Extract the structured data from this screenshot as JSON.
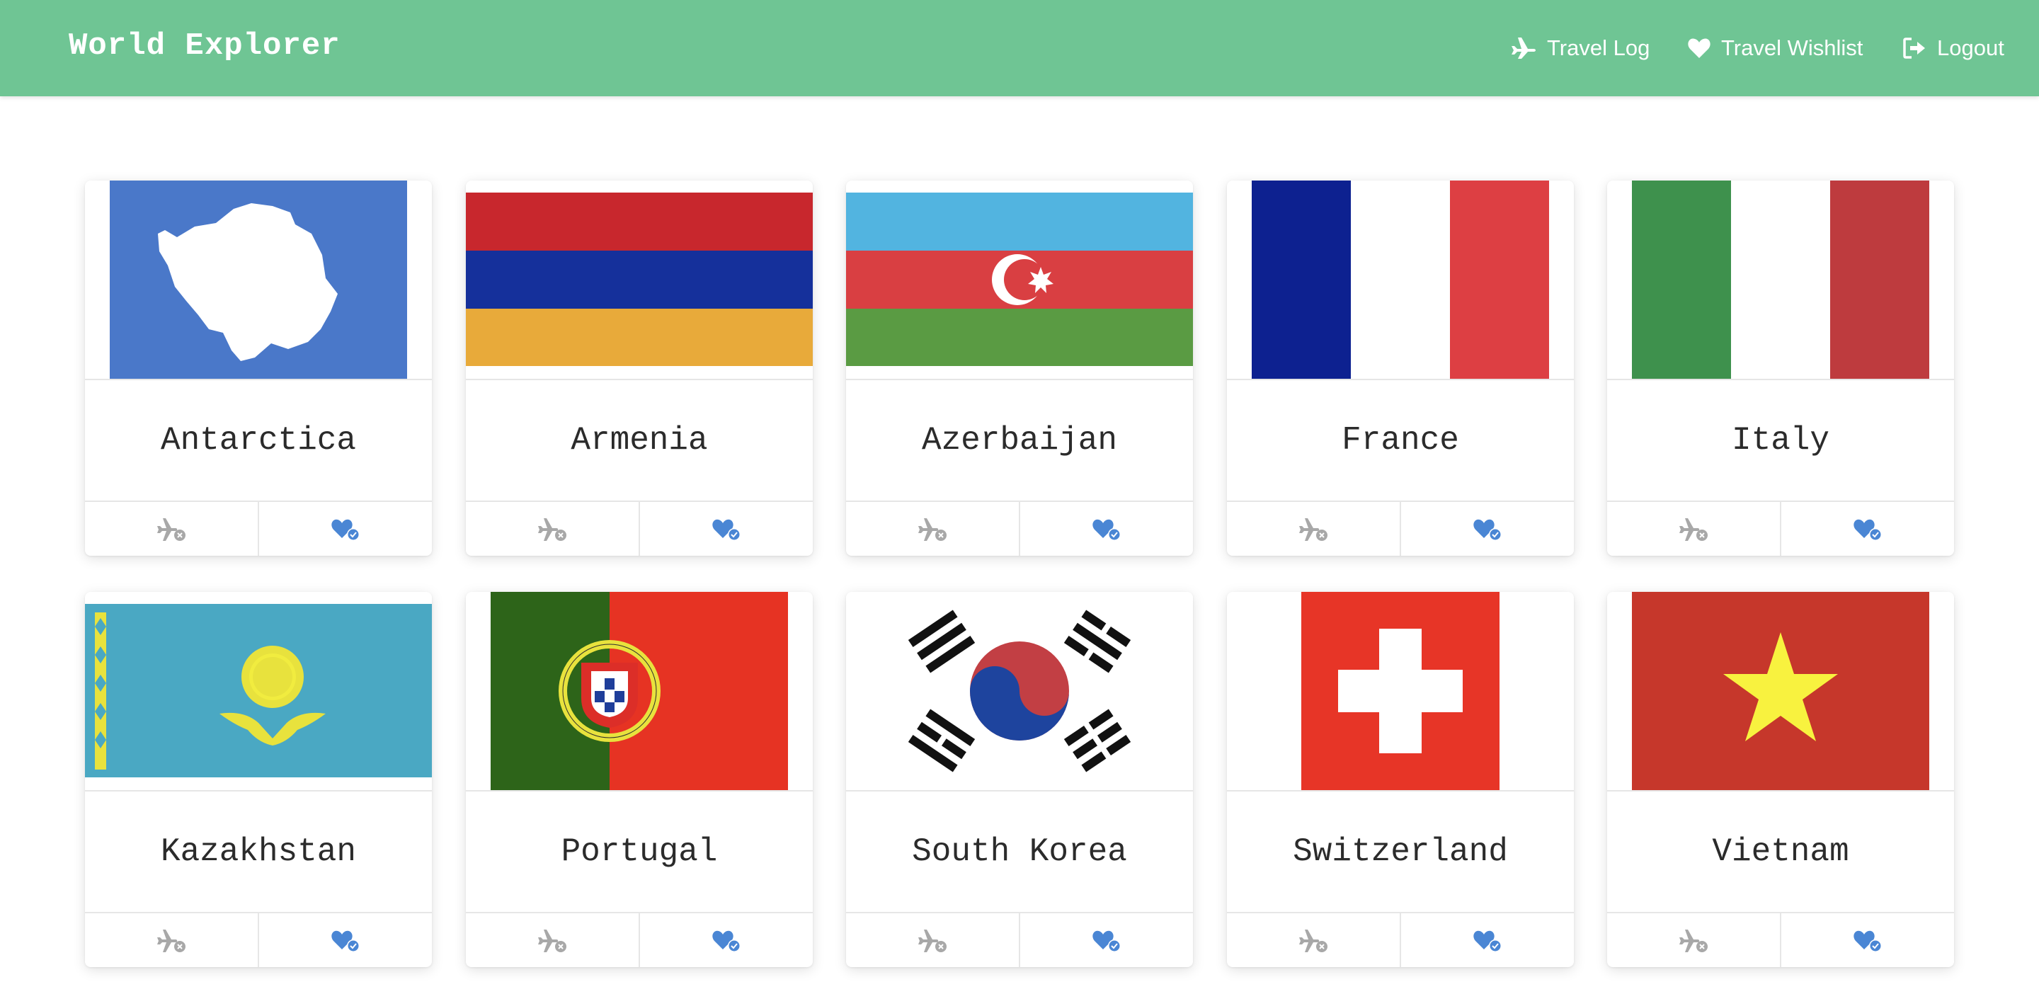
{
  "app": {
    "brand": "World Explorer",
    "brand_color": "#6fc594",
    "nav": {
      "travel_log": "Travel Log",
      "travel_wishlist": "Travel Wishlist",
      "logout": "Logout"
    }
  },
  "icons": {
    "travel_log_nav": "plane-icon",
    "wishlist_nav": "heart-icon",
    "logout_nav": "sign-out-icon",
    "card_visited": "plane-x-icon",
    "card_wishlist": "heart-check-icon",
    "card_visited_color": "#a8a8a8",
    "card_wishlist_color": "#4a86d4"
  },
  "countries": [
    {
      "name": "Antarctica",
      "flag": "antarctica-flag"
    },
    {
      "name": "Armenia",
      "flag": "armenia-flag"
    },
    {
      "name": "Azerbaijan",
      "flag": "azerbaijan-flag"
    },
    {
      "name": "France",
      "flag": "france-flag"
    },
    {
      "name": "Italy",
      "flag": "italy-flag"
    },
    {
      "name": "Kazakhstan",
      "flag": "kazakhstan-flag"
    },
    {
      "name": "Portugal",
      "flag": "portugal-flag"
    },
    {
      "name": "South Korea",
      "flag": "south-korea-flag"
    },
    {
      "name": "Switzerland",
      "flag": "switzerland-flag"
    },
    {
      "name": "Vietnam",
      "flag": "vietnam-flag"
    }
  ]
}
